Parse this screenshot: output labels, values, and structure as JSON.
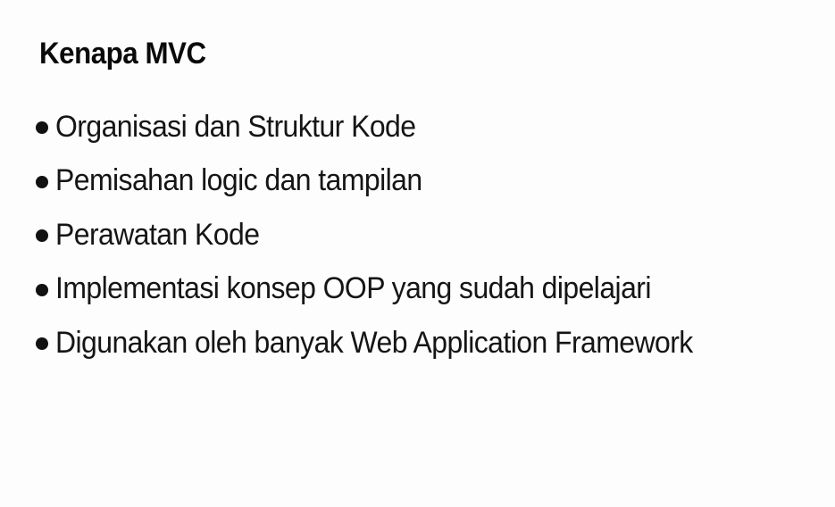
{
  "slide": {
    "title": "Kenapa MVC",
    "bullets": [
      "Organisasi dan Struktur Kode",
      "Pemisahan logic dan tampilan",
      "Perawatan Kode",
      "Implementasi konsep OOP yang sudah dipelajari",
      "Digunakan oleh banyak Web Application Framework"
    ]
  }
}
